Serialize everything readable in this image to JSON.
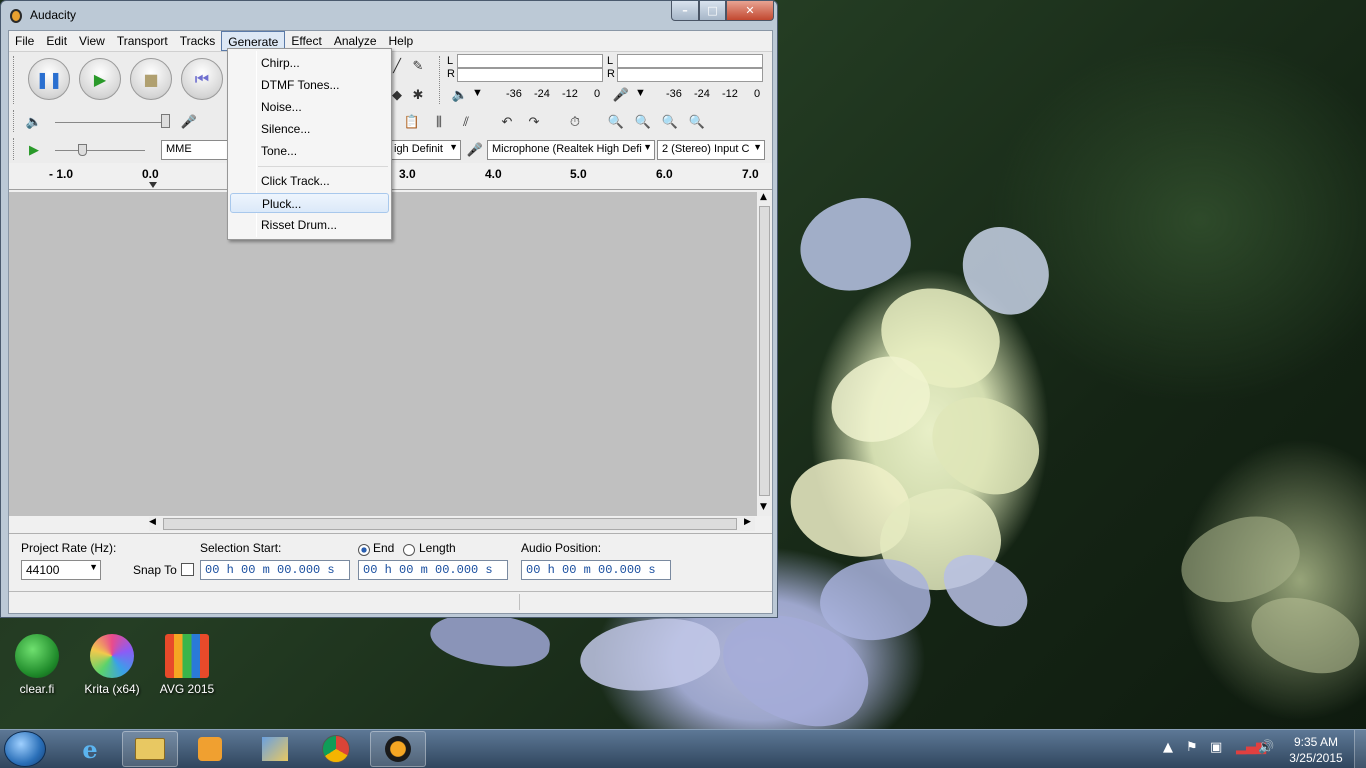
{
  "window": {
    "title": "Audacity",
    "controls": {
      "minimize": "–",
      "maximize": "□",
      "close": "✕"
    }
  },
  "menubar": {
    "items": [
      {
        "label": "File"
      },
      {
        "label": "Edit"
      },
      {
        "label": "View"
      },
      {
        "label": "Transport"
      },
      {
        "label": "Tracks"
      },
      {
        "label": "Generate",
        "active": true
      },
      {
        "label": "Effect"
      },
      {
        "label": "Analyze"
      },
      {
        "label": "Help"
      }
    ]
  },
  "meters": {
    "play_l": "L",
    "play_r": "R",
    "rec_l": "L",
    "rec_r": "R",
    "scale_play": [
      "-36",
      "-24",
      "-12",
      "0"
    ],
    "scale_rec": [
      "-36",
      "-24",
      "-12",
      "0"
    ]
  },
  "device": {
    "host": "MME",
    "output": "igh Definit",
    "input": "Microphone (Realtek High Defi",
    "channels": "2 (Stereo) Input C"
  },
  "ruler": {
    "ticks": [
      "- 1.0",
      "0.0",
      "3.0",
      "4.0",
      "5.0",
      "6.0",
      "7.0"
    ]
  },
  "generate_menu": {
    "items": [
      "Chirp...",
      "DTMF Tones...",
      "Noise...",
      "Silence...",
      "Tone..."
    ],
    "items2": [
      "Click Track...",
      "Pluck...",
      "Risset Drum..."
    ],
    "highlighted": "Pluck..."
  },
  "selection_bar": {
    "project_rate_label": "Project Rate (Hz):",
    "project_rate_value": "44100",
    "snap_to_label": "Snap To",
    "selection_start_label": "Selection Start:",
    "end_label": "End",
    "length_label": "Length",
    "audio_position_label": "Audio Position:",
    "time_start": "00 h 00 m 00.000 s",
    "time_end": "00 h 00 m 00.000 s",
    "time_audio": "00 h 00 m 00.000 s"
  },
  "desktop_icons": [
    {
      "label": "clear.fi"
    },
    {
      "label": "Krita (x64)"
    },
    {
      "label": "AVG 2015"
    }
  ],
  "taskbar": {
    "clock_time": "9:35 AM",
    "clock_date": "3/25/2015"
  },
  "colors": {
    "menu_highlight": "#dbe9f9",
    "time_digits": "#1a4fa0",
    "track_bg": "#c0c0c0"
  }
}
